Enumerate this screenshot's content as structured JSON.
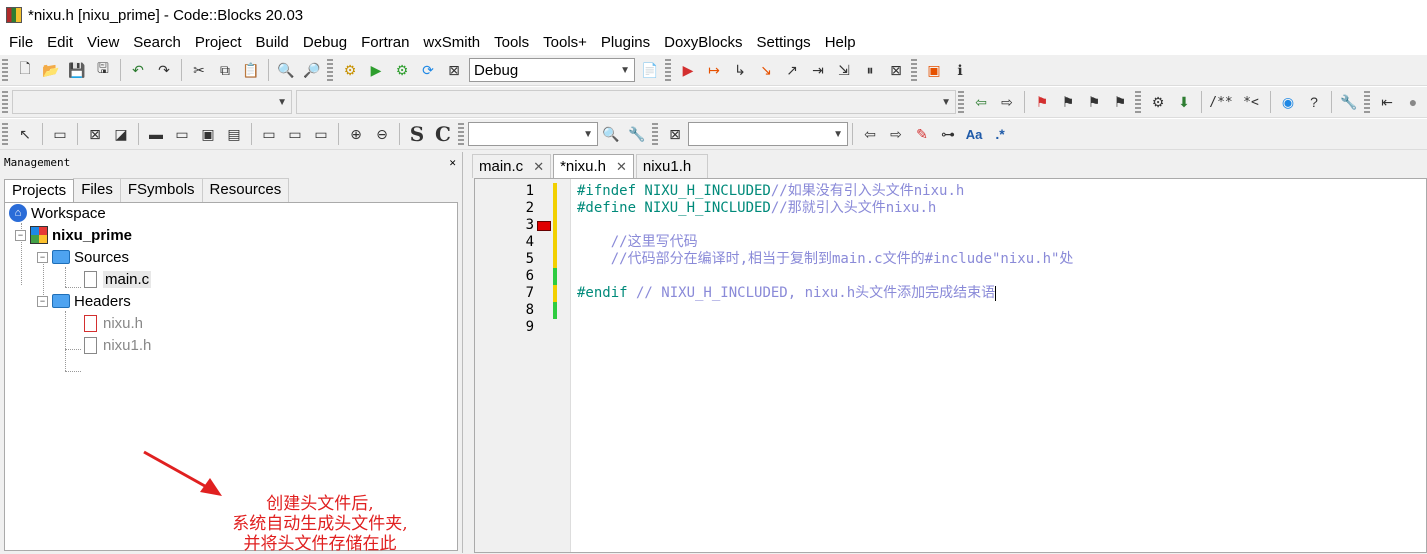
{
  "window": {
    "title": "*nixu.h [nixu_prime] - Code::Blocks 20.03"
  },
  "menubar": [
    "File",
    "Edit",
    "View",
    "Search",
    "Project",
    "Build",
    "Debug",
    "Fortran",
    "wxSmith",
    "Tools",
    "Tools+",
    "Plugins",
    "DoxyBlocks",
    "Settings",
    "Help"
  ],
  "toolbar": {
    "build_target": "Debug",
    "doxy_comment": "/**",
    "doxy_line": "*<",
    "regex_label": ".*"
  },
  "management": {
    "title": "Management",
    "close": "✕",
    "tabs": [
      "Projects",
      "Files",
      "FSymbols",
      "Resources"
    ],
    "tree": {
      "workspace": "Workspace",
      "project": "nixu_prime",
      "sources": "Sources",
      "source_files": [
        "main.c"
      ],
      "headers": "Headers",
      "header_files": [
        "nixu.h",
        "nixu1.h"
      ]
    },
    "annotation": [
      "创建头文件后,",
      "系统自动生成头文件夹,",
      "并将头文件存储在此"
    ]
  },
  "editor": {
    "tabs": [
      {
        "label": "main.c",
        "close": "✕"
      },
      {
        "label": "*nixu.h",
        "close": "✕"
      },
      {
        "label": "nixu1.h",
        "close": ""
      }
    ],
    "lines": [
      {
        "n": "1",
        "pp": "#ifndef NIXU_H_INCLUDED",
        "cm": "//如果没有引入头文件nixu.h"
      },
      {
        "n": "2",
        "pp": "#define NIXU_H_INCLUDED",
        "cm": "//那就引入头文件nixu.h"
      },
      {
        "n": "3",
        "pp": "",
        "cm": ""
      },
      {
        "n": "4",
        "pp": "    ",
        "cm": "//这里写代码"
      },
      {
        "n": "5",
        "pp": "    ",
        "cm": "//代码部分在编译时,相当于复制到main.c文件的#include\"nixu.h\"处"
      },
      {
        "n": "6",
        "pp": "",
        "cm": ""
      },
      {
        "n": "7",
        "pp": "#endif",
        "cm": " // NIXU_H_INCLUDED, nixu.h头文件添加完成结束语"
      },
      {
        "n": "8",
        "pp": "",
        "cm": ""
      },
      {
        "n": "9",
        "pp": "",
        "cm": ""
      }
    ]
  },
  "colors": {
    "preprocessor": "#008a7a",
    "comment": "#8a8ad8",
    "annotation": "#e02020",
    "bookmark": "#e00000",
    "changed": "#f2d000",
    "saved": "#2ecc40"
  }
}
